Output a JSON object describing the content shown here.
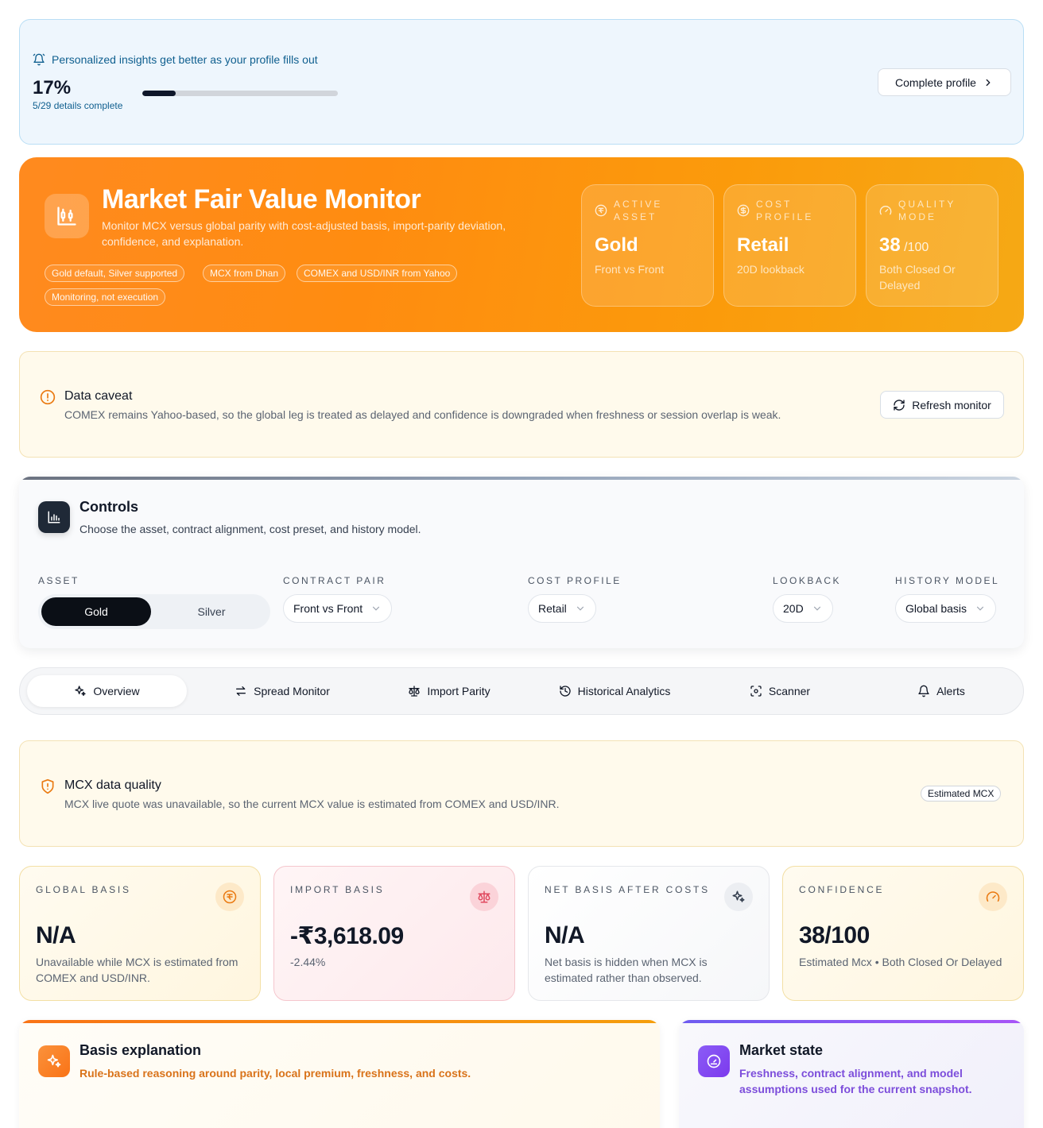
{
  "profile": {
    "note": "Personalized insights get better as your profile fills out",
    "percent": "17%",
    "progress": 0.17,
    "details": "5/29 details complete",
    "cta": "Complete profile"
  },
  "hero": {
    "title": "Market Fair Value Monitor",
    "description": "Monitor MCX versus global parity with cost-adjusted basis, import-parity deviation, confidence, and explanation.",
    "chips": [
      "Gold default, Silver supported",
      "MCX from Dhan",
      "COMEX and USD/INR from Yahoo",
      "Monitoring, not execution"
    ],
    "stats": [
      {
        "label": "ACTIVE ASSET",
        "value": "Gold",
        "suffix": "",
        "sub": "Front vs Front"
      },
      {
        "label": "COST PROFILE",
        "value": "Retail",
        "suffix": "",
        "sub": "20D lookback"
      },
      {
        "label": "QUALITY MODE",
        "value": "38",
        "suffix": " /100",
        "sub": "Both Closed Or Delayed"
      }
    ]
  },
  "caveat": {
    "title": "Data caveat",
    "text": "COMEX remains Yahoo-based, so the global leg is treated as delayed and confidence is downgraded when freshness or session overlap is weak.",
    "button": "Refresh monitor"
  },
  "controls": {
    "title": "Controls",
    "subtitle": "Choose the asset, contract alignment, cost preset, and history model.",
    "asset_label": "ASSET",
    "asset_options": [
      "Gold",
      "Silver"
    ],
    "contract_label": "CONTRACT PAIR",
    "contract_value": "Front vs Front",
    "cost_label": "COST PROFILE",
    "cost_value": "Retail",
    "lookback_label": "LOOKBACK",
    "lookback_value": "20D",
    "history_label": "HISTORY MODEL",
    "history_value": "Global basis"
  },
  "tabs": [
    "Overview",
    "Spread Monitor",
    "Import Parity",
    "Historical Analytics",
    "Scanner",
    "Alerts"
  ],
  "quality": {
    "title": "MCX data quality",
    "text": "MCX live quote was unavailable, so the current MCX value is estimated from COMEX and USD/INR.",
    "badge": "Estimated MCX"
  },
  "metrics": [
    {
      "label": "GLOBAL BASIS",
      "value": "N/A",
      "sub": "Unavailable while MCX is estimated from COMEX and USD/INR."
    },
    {
      "label": "IMPORT BASIS",
      "value": "-₹3,618.09",
      "sub": "-2.44%"
    },
    {
      "label": "NET BASIS AFTER COSTS",
      "value": "N/A",
      "sub": "Net basis is hidden when MCX is estimated rather than observed."
    },
    {
      "label": "CONFIDENCE",
      "value": "38/100",
      "sub": "Estimated Mcx • Both Closed Or Delayed"
    }
  ],
  "panels": {
    "basis": {
      "title": "Basis explanation",
      "subtitle": "Rule-based reasoning around parity, local premium, freshness, and costs."
    },
    "market": {
      "title": "Market state",
      "subtitle": "Freshness, contract alignment, and model assumptions used for the current snapshot."
    }
  },
  "colors": {
    "accent": "#ff8a1f",
    "caveat_bg": "#fffaec",
    "purple": "#7c3aed"
  }
}
